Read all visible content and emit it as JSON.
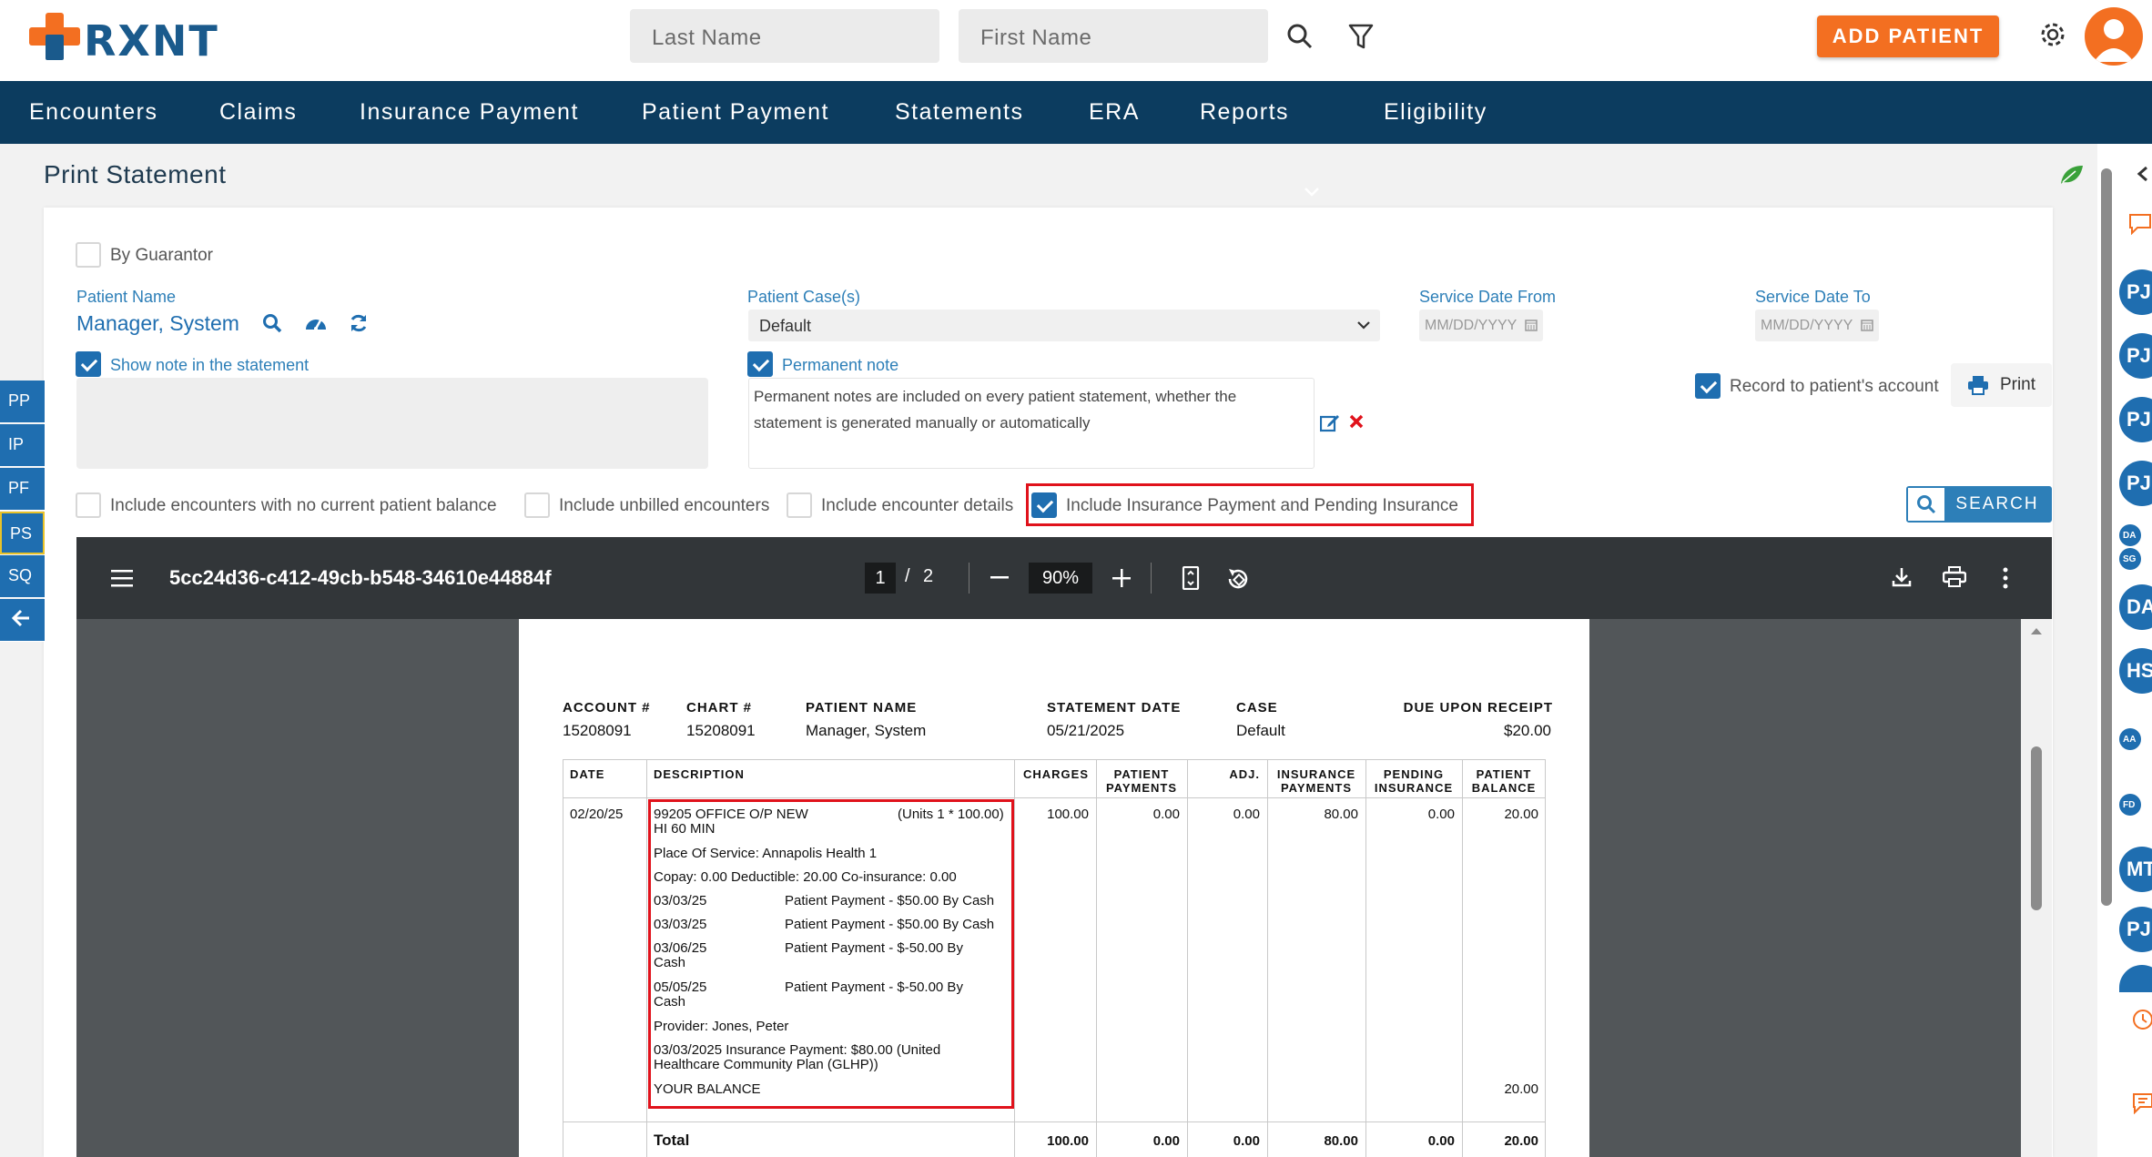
{
  "header": {
    "logo_text": "RXNT",
    "last_name_placeholder": "Last Name",
    "first_name_placeholder": "First Name",
    "add_patient_label": "ADD PATIENT"
  },
  "nav": {
    "items": [
      "Encounters",
      "Claims",
      "Insurance Payment",
      "Patient Payment",
      "Statements",
      "ERA",
      "Reports",
      "Eligibility"
    ]
  },
  "page": {
    "title": "Print Statement"
  },
  "form": {
    "by_guarantor_label": "By Guarantor",
    "patient_name_label": "Patient Name",
    "patient_name_value": "Manager, System",
    "show_note_label": "Show note in the statement",
    "patient_cases_label": "Patient Case(s)",
    "patient_cases_value": "Default",
    "service_date_from_label": "Service Date From",
    "service_date_to_label": "Service Date To",
    "date_placeholder": "MM/DD/YYYY",
    "permanent_note_label": "Permanent note",
    "permanent_note_text_1": "Permanent notes are included on every patient statement, whether the",
    "permanent_note_text_2": "statement is generated manually or automatically",
    "record_account_label": "Record to patient's account",
    "print_label": "Print",
    "include_no_balance_label": "Include encounters with no current patient balance",
    "include_unbilled_label": "Include unbilled encounters",
    "include_details_label": "Include encounter details",
    "include_insurance_label": "Include Insurance Payment and Pending Insurance",
    "search_label": "SEARCH"
  },
  "left_tabs": [
    "PP",
    "IP",
    "PF",
    "PS",
    "SQ"
  ],
  "pdf": {
    "file_name": "5cc24d36-c412-49cb-b548-34610e44884f",
    "page_current": "1",
    "page_sep": "/",
    "page_total": "2",
    "zoom": "90%"
  },
  "statement": {
    "account_label": "ACCOUNT #",
    "account_value": "15208091",
    "chart_label": "CHART #",
    "chart_value": "15208091",
    "patient_label": "PATIENT NAME",
    "patient_value": "Manager, System",
    "date_label": "STATEMENT DATE",
    "date_value": "05/21/2025",
    "case_label": "CASE",
    "case_value": "Default",
    "due_label": "DUE UPON RECEIPT",
    "due_value": "$20.00",
    "columns": {
      "date": "DATE",
      "description": "DESCRIPTION",
      "charges": "CHARGES",
      "patient_payments_1": "PATIENT",
      "patient_payments_2": "PAYMENTS",
      "adj": "ADJ.",
      "insurance_payments_1": "INSURANCE",
      "insurance_payments_2": "PAYMENTS",
      "pending_insurance_1": "PENDING",
      "pending_insurance_2": "INSURANCE",
      "patient_balance_1": "PATIENT",
      "patient_balance_2": "BALANCE"
    },
    "row": {
      "date": "02/20/25",
      "code": "99205 OFFICE O/P NEW",
      "units": "(Units 1 * 100.00)",
      "code_line2": "HI 60 MIN",
      "place": "Place Of Service: Annapolis Health 1",
      "copay": "Copay: 0.00  Deductible: 20.00 Co-insurance: 0.00",
      "p1_date": "03/03/25",
      "p1_text": "Patient Payment - $50.00 By Cash",
      "p2_date": "03/03/25",
      "p2_text": "Patient Payment - $50.00 By Cash",
      "p3_date": "03/06/25",
      "p3_text": "Patient Payment - $-50.00 By",
      "p3_cont": "Cash",
      "p4_date": "05/05/25",
      "p4_text": "Patient Payment - $-50.00 By",
      "p4_cont": "Cash",
      "provider": "Provider: Jones, Peter",
      "ins_line1": "03/03/2025 Insurance Payment: $80.00 (United",
      "ins_line2": "Healthcare Community Plan (GLHP))",
      "your_balance": "YOUR BALANCE",
      "charges": "100.00",
      "patient_payments": "0.00",
      "adj": "0.00",
      "insurance_payments": "80.00",
      "pending_insurance": "0.00",
      "patient_balance": "20.00",
      "your_balance_value": "20.00"
    },
    "total": {
      "label": "Total",
      "charges": "100.00",
      "patient_payments": "0.00",
      "adj": "0.00",
      "insurance_payments": "80.00",
      "pending_insurance": "0.00",
      "patient_balance": "20.00"
    }
  },
  "right_rail": {
    "items": [
      "PJ",
      "PJ",
      "PJ",
      "PJ",
      "DA",
      "SG",
      "DA",
      "HS",
      "AA",
      "FD",
      "MT",
      "PJ"
    ]
  },
  "colors": {
    "brand_blue": "#0c3c5f",
    "accent_orange": "#f36f21",
    "link_blue": "#2d7fb8",
    "highlight_red": "#e0121b"
  }
}
